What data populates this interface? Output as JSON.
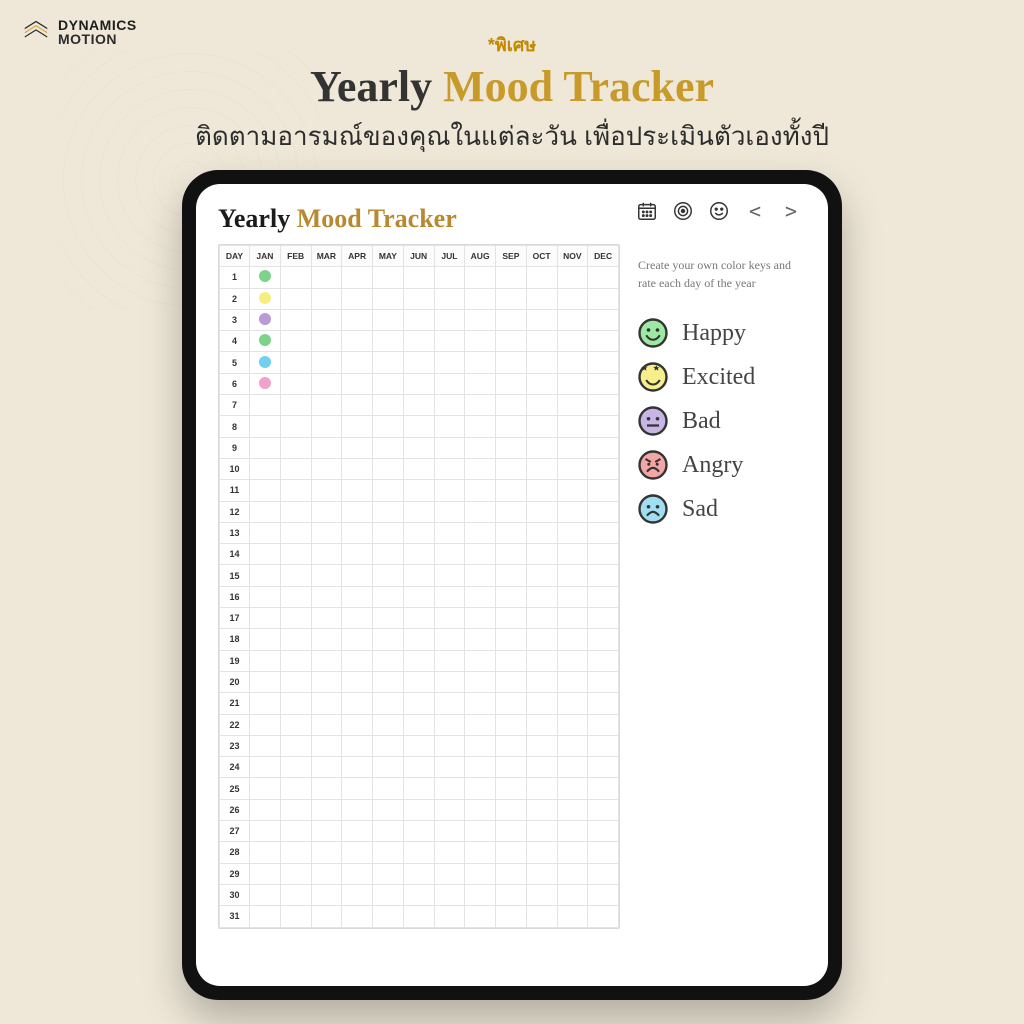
{
  "brand": {
    "line1": "DYNAMICS",
    "line2": "MOTION"
  },
  "promo": {
    "special": "*พิเศษ",
    "title_part1": "Yearly ",
    "title_part2": "Mood Tracker",
    "subtitle": "ติดตามอารมณ์ของคุณในแต่ละวัน เพื่อประเมินตัวเองทั้งปี"
  },
  "screen": {
    "title_part1": "Yearly ",
    "title_part2": "Mood Tracker"
  },
  "table": {
    "day_header": "DAY",
    "months": [
      "JAN",
      "FEB",
      "MAR",
      "APR",
      "MAY",
      "JUN",
      "JUL",
      "AUG",
      "SEP",
      "OCT",
      "NOV",
      "DEC"
    ],
    "days": 31,
    "filled": {
      "JAN": {
        "1": "#7fd289",
        "2": "#f4f07f",
        "3": "#b79ad6",
        "4": "#7fd289",
        "5": "#6fd1ef",
        "6": "#f1a2c8"
      }
    }
  },
  "sidebar": {
    "note": "Create your own color keys and rate each day of the year",
    "legend": [
      {
        "label": "Happy",
        "color": "#9de8a3",
        "face": "happy"
      },
      {
        "label": "Excited",
        "color": "#f7f08a",
        "face": "excited"
      },
      {
        "label": "Bad",
        "color": "#c7b5e6",
        "face": "bad"
      },
      {
        "label": "Angry",
        "color": "#f3a6a6",
        "face": "angry"
      },
      {
        "label": "Sad",
        "color": "#a0dff2",
        "face": "sad"
      }
    ]
  },
  "toolbar": {
    "prev": "<",
    "next": ">"
  }
}
